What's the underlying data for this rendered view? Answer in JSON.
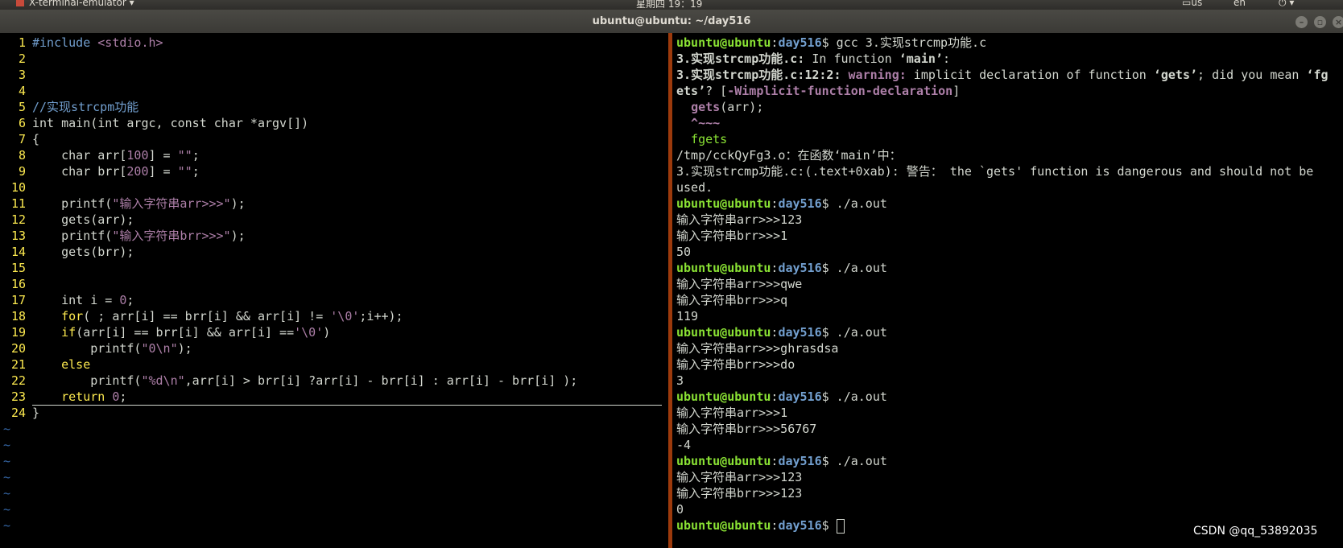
{
  "system_panel": {
    "app_name": "X-terminal-emulator",
    "clock": "星期四 19：19",
    "keyboard": "us",
    "language": "en"
  },
  "window": {
    "title": "ubuntu@ubuntu: ~/day516"
  },
  "colors": {
    "background": "#000000",
    "line_number": "#fce94f",
    "prompt_user": "#8ae234",
    "prompt_dir": "#729fcf",
    "warning": "#ad7fa8",
    "divider": "#9c3a0c"
  },
  "editor": {
    "lines": [
      {
        "n": "1",
        "segs": [
          {
            "t": "#include ",
            "c": "#729fcf"
          },
          {
            "t": "<stdio.h>",
            "c": "#ad7fa8"
          }
        ]
      },
      {
        "n": "2",
        "segs": []
      },
      {
        "n": "3",
        "segs": []
      },
      {
        "n": "4",
        "segs": []
      },
      {
        "n": "5",
        "segs": [
          {
            "t": "//实现strcpm功能",
            "c": "#729fcf"
          }
        ]
      },
      {
        "n": "6",
        "segs": [
          {
            "t": "int main(int argc, const char *argv[])",
            "c": "#d3d7cf"
          }
        ]
      },
      {
        "n": "7",
        "segs": [
          {
            "t": "{",
            "c": "#d3d7cf"
          }
        ]
      },
      {
        "n": "8",
        "segs": [
          {
            "t": "    char arr[",
            "c": "#d3d7cf"
          },
          {
            "t": "100",
            "c": "#ad7fa8"
          },
          {
            "t": "] = ",
            "c": "#d3d7cf"
          },
          {
            "t": "\"\"",
            "c": "#ad7fa8"
          },
          {
            "t": ";",
            "c": "#d3d7cf"
          }
        ]
      },
      {
        "n": "9",
        "segs": [
          {
            "t": "    char brr[",
            "c": "#d3d7cf"
          },
          {
            "t": "200",
            "c": "#ad7fa8"
          },
          {
            "t": "] = ",
            "c": "#d3d7cf"
          },
          {
            "t": "\"\"",
            "c": "#ad7fa8"
          },
          {
            "t": ";",
            "c": "#d3d7cf"
          }
        ]
      },
      {
        "n": "10",
        "segs": []
      },
      {
        "n": "11",
        "segs": [
          {
            "t": "    printf(",
            "c": "#d3d7cf"
          },
          {
            "t": "\"输入字符串arr>>>\"",
            "c": "#ad7fa8"
          },
          {
            "t": ");",
            "c": "#d3d7cf"
          }
        ]
      },
      {
        "n": "12",
        "segs": [
          {
            "t": "    gets(arr);",
            "c": "#d3d7cf"
          }
        ]
      },
      {
        "n": "13",
        "segs": [
          {
            "t": "    printf(",
            "c": "#d3d7cf"
          },
          {
            "t": "\"输入字符串brr>>>\"",
            "c": "#ad7fa8"
          },
          {
            "t": ");",
            "c": "#d3d7cf"
          }
        ]
      },
      {
        "n": "14",
        "segs": [
          {
            "t": "    gets(brr);",
            "c": "#d3d7cf"
          }
        ]
      },
      {
        "n": "15",
        "segs": []
      },
      {
        "n": "16",
        "segs": []
      },
      {
        "n": "17",
        "segs": [
          {
            "t": "    int i = ",
            "c": "#d3d7cf"
          },
          {
            "t": "0",
            "c": "#ad7fa8"
          },
          {
            "t": ";",
            "c": "#d3d7cf"
          }
        ]
      },
      {
        "n": "18",
        "segs": [
          {
            "t": "    for",
            "c": "#fce94f"
          },
          {
            "t": "( ; arr[i] == brr[i] && arr[i] != ",
            "c": "#d3d7cf"
          },
          {
            "t": "'\\0'",
            "c": "#ad7fa8"
          },
          {
            "t": ";i++);",
            "c": "#d3d7cf"
          }
        ]
      },
      {
        "n": "19",
        "segs": [
          {
            "t": "    if",
            "c": "#fce94f"
          },
          {
            "t": "(arr[i] == brr[i] && arr[i] ==",
            "c": "#d3d7cf"
          },
          {
            "t": "'\\0'",
            "c": "#ad7fa8"
          },
          {
            "t": ")",
            "c": "#d3d7cf"
          }
        ]
      },
      {
        "n": "20",
        "segs": [
          {
            "t": "        printf(",
            "c": "#d3d7cf"
          },
          {
            "t": "\"0\\n\"",
            "c": "#ad7fa8"
          },
          {
            "t": ");",
            "c": "#d3d7cf"
          }
        ]
      },
      {
        "n": "21",
        "segs": [
          {
            "t": "    else",
            "c": "#fce94f"
          }
        ]
      },
      {
        "n": "22",
        "segs": [
          {
            "t": "        printf(",
            "c": "#d3d7cf"
          },
          {
            "t": "\"%d\\n\"",
            "c": "#ad7fa8"
          },
          {
            "t": ",arr[i] > brr[i] ?arr[i] - brr[i] : arr[i] - brr[i] );",
            "c": "#d3d7cf"
          }
        ]
      },
      {
        "n": "23",
        "segs": [
          {
            "t": "    return ",
            "c": "#fce94f"
          },
          {
            "t": "0",
            "c": "#ad7fa8"
          },
          {
            "t": ";",
            "c": "#d3d7cf"
          }
        ]
      },
      {
        "n": "24",
        "segs": [
          {
            "t": "}",
            "c": "#d3d7cf"
          }
        ]
      }
    ],
    "tilde": "~",
    "tilde_count": 7
  },
  "terminal": {
    "prompt_user": "ubuntu@ubuntu",
    "prompt_dir": "day516",
    "lines": [
      {
        "prompt": true,
        "segs": [
          {
            "t": "$ gcc 3.实现strcmp功能.c",
            "c": "#d3d7cf"
          }
        ]
      },
      {
        "segs": [
          {
            "t": "3.实现strcmp功能.c:",
            "c": "#d3d7cf",
            "b": true
          },
          {
            "t": " In function ",
            "c": "#d3d7cf"
          },
          {
            "t": "‘main’",
            "c": "#d3d7cf",
            "b": true
          },
          {
            "t": ":",
            "c": "#d3d7cf"
          }
        ]
      },
      {
        "segs": [
          {
            "t": "3.实现strcmp功能.c:12:2:",
            "c": "#d3d7cf",
            "b": true
          },
          {
            "t": " warning:",
            "c": "#ad7fa8",
            "b": true
          },
          {
            "t": " implicit declaration of function ",
            "c": "#d3d7cf"
          },
          {
            "t": "‘gets’",
            "c": "#d3d7cf",
            "b": true
          },
          {
            "t": "; did you mean ",
            "c": "#d3d7cf"
          },
          {
            "t": "‘fg",
            "c": "#d3d7cf",
            "b": true
          }
        ]
      },
      {
        "segs": [
          {
            "t": "ets’",
            "c": "#d3d7cf",
            "b": true
          },
          {
            "t": "? [",
            "c": "#d3d7cf"
          },
          {
            "t": "-Wimplicit-function-declaration",
            "c": "#ad7fa8",
            "b": true
          },
          {
            "t": "]",
            "c": "#d3d7cf"
          }
        ]
      },
      {
        "segs": [
          {
            "t": "  ",
            "c": "#d3d7cf"
          },
          {
            "t": "gets",
            "c": "#ad7fa8",
            "b": true
          },
          {
            "t": "(arr);",
            "c": "#d3d7cf"
          }
        ]
      },
      {
        "segs": [
          {
            "t": "  ^~~~",
            "c": "#ad7fa8",
            "b": true
          }
        ]
      },
      {
        "segs": [
          {
            "t": "  fgets",
            "c": "#8ae234"
          }
        ]
      },
      {
        "segs": [
          {
            "t": "/tmp/cckQyFg3.o：在函数‘main’中：",
            "c": "#d3d7cf"
          }
        ]
      },
      {
        "segs": [
          {
            "t": "3.实现strcmp功能.c:(.text+0xab): 警告： the `gets' function is dangerous and should not be",
            "c": "#d3d7cf"
          }
        ]
      },
      {
        "segs": [
          {
            "t": "used.",
            "c": "#d3d7cf"
          }
        ]
      },
      {
        "prompt": true,
        "segs": [
          {
            "t": "$ ./a.out",
            "c": "#d3d7cf"
          }
        ]
      },
      {
        "segs": [
          {
            "t": "输入字符串arr>>>123",
            "c": "#d3d7cf"
          }
        ]
      },
      {
        "segs": [
          {
            "t": "输入字符串brr>>>1",
            "c": "#d3d7cf"
          }
        ]
      },
      {
        "segs": [
          {
            "t": "50",
            "c": "#d3d7cf"
          }
        ]
      },
      {
        "prompt": true,
        "segs": [
          {
            "t": "$ ./a.out",
            "c": "#d3d7cf"
          }
        ]
      },
      {
        "segs": [
          {
            "t": "输入字符串arr>>>qwe",
            "c": "#d3d7cf"
          }
        ]
      },
      {
        "segs": [
          {
            "t": "输入字符串brr>>>q",
            "c": "#d3d7cf"
          }
        ]
      },
      {
        "segs": [
          {
            "t": "119",
            "c": "#d3d7cf"
          }
        ]
      },
      {
        "prompt": true,
        "segs": [
          {
            "t": "$ ./a.out",
            "c": "#d3d7cf"
          }
        ]
      },
      {
        "segs": [
          {
            "t": "输入字符串arr>>>ghrasdsa",
            "c": "#d3d7cf"
          }
        ]
      },
      {
        "segs": [
          {
            "t": "输入字符串brr>>>do",
            "c": "#d3d7cf"
          }
        ]
      },
      {
        "segs": [
          {
            "t": "3",
            "c": "#d3d7cf"
          }
        ]
      },
      {
        "prompt": true,
        "segs": [
          {
            "t": "$ ./a.out",
            "c": "#d3d7cf"
          }
        ]
      },
      {
        "segs": [
          {
            "t": "输入字符串arr>>>1",
            "c": "#d3d7cf"
          }
        ]
      },
      {
        "segs": [
          {
            "t": "输入字符串brr>>>56767",
            "c": "#d3d7cf"
          }
        ]
      },
      {
        "segs": [
          {
            "t": "-4",
            "c": "#d3d7cf"
          }
        ]
      },
      {
        "prompt": true,
        "segs": [
          {
            "t": "$ ./a.out",
            "c": "#d3d7cf"
          }
        ]
      },
      {
        "segs": [
          {
            "t": "输入字符串arr>>>123",
            "c": "#d3d7cf"
          }
        ]
      },
      {
        "segs": [
          {
            "t": "输入字符串brr>>>123",
            "c": "#d3d7cf"
          }
        ]
      },
      {
        "segs": [
          {
            "t": "0",
            "c": "#d3d7cf"
          }
        ]
      },
      {
        "prompt": true,
        "cursor": true,
        "segs": [
          {
            "t": "$ ",
            "c": "#d3d7cf"
          }
        ]
      }
    ]
  },
  "watermark": "CSDN @qq_53892035"
}
